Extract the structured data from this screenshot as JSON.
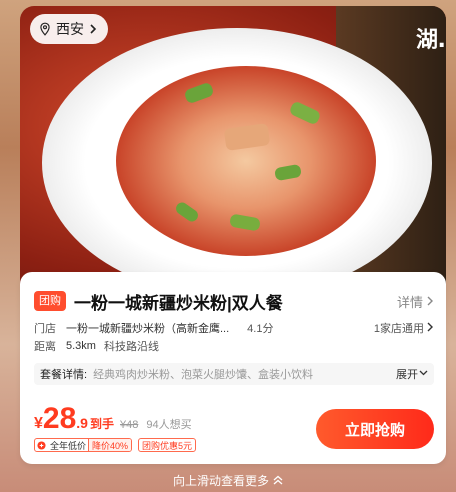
{
  "hero": {
    "location": "西安",
    "side_text": "湖…"
  },
  "deal": {
    "tag": "团购",
    "title": "一粉一城新疆炒米粉|双人餐",
    "detail_label": "详情"
  },
  "store": {
    "key": "门店",
    "name": "一粉一城新疆炒米粉（高新金鹰...",
    "rating": "4.1分",
    "stores_label": "1家店通用"
  },
  "distance": {
    "key": "距离",
    "value": "5.3km",
    "road": "科技路沿线"
  },
  "package": {
    "label": "套餐详情:",
    "items": "经典鸡肉炒米粉、泡菜火腿炒馕、盒装小饮料",
    "expand_label": "展开"
  },
  "price": {
    "currency": "¥",
    "integer": "28",
    "decimal": ".9",
    "suffix": "到手",
    "original": "¥48",
    "want_count": "94人想买"
  },
  "badges": {
    "lowest_main": "全年低价",
    "lowest_drop": "降价40%",
    "coupon": "团购优惠5元"
  },
  "buy_button": "立即抢购",
  "swipe_hint": "向上滑动查看更多",
  "colors": {
    "accent": "#ff3b1f",
    "tag": "#ff4d2e"
  }
}
